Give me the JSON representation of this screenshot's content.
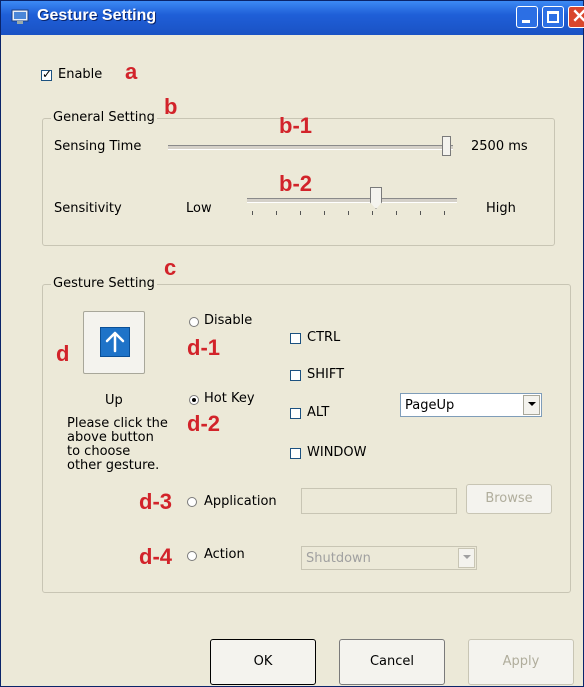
{
  "window": {
    "title": "Gesture Setting"
  },
  "enable": {
    "label": "Enable",
    "checked": true,
    "marker": "a"
  },
  "general": {
    "title": "General Setting",
    "marker": "b",
    "sensing_time": {
      "label": "Sensing Time",
      "value": "2500 ms",
      "marker": "b-1"
    },
    "sensitivity": {
      "label": "Sensitivity",
      "low": "Low",
      "high": "High",
      "marker": "b-2"
    }
  },
  "gesture": {
    "title": "Gesture Setting",
    "marker": "c",
    "button_marker": "d",
    "gesture_name": "Up",
    "help_lines": [
      "Please click the",
      "above button",
      "to choose",
      "other gesture."
    ],
    "disable": {
      "label": "Disable",
      "marker": "d-1"
    },
    "hotkey": {
      "label": "Hot Key",
      "marker": "d-2"
    },
    "modifiers": {
      "ctrl": "CTRL",
      "shift": "SHIFT",
      "alt": "ALT",
      "window": "WINDOW"
    },
    "key_select": "PageUp",
    "application": {
      "label": "Application",
      "marker": "d-3",
      "browse": "Browse"
    },
    "action": {
      "label": "Action",
      "marker": "d-4",
      "select": "Shutdown"
    }
  },
  "buttons": {
    "ok": "OK",
    "cancel": "Cancel",
    "apply": "Apply"
  },
  "colors": {
    "titlebar": "#1f5fd8",
    "dialog": "#ece9d8",
    "annotation": "#d2232a",
    "gesture_button": "#1e73c8"
  }
}
